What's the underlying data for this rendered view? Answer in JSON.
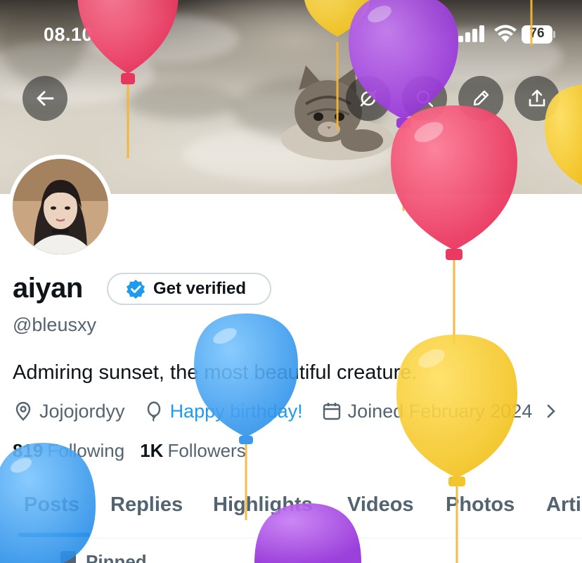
{
  "status_bar": {
    "time": "08.10",
    "battery": "76"
  },
  "profile": {
    "name": "aiyan",
    "verify_label": "Get verified",
    "handle": "@bleusxy",
    "bio": "Admiring sunset, the most beautiful creature.",
    "location": "Jojojordyy",
    "birthday": "Happy birthday!",
    "joined": "Joined February 2024",
    "following_count": "819",
    "following_label": "Following",
    "followers_count": "1K",
    "followers_label": "Followers"
  },
  "tabs": [
    "Posts",
    "Replies",
    "Highlights",
    "Videos",
    "Photos",
    "Arti"
  ],
  "active_tab": "Posts",
  "pinned_label": "Pinned",
  "icons": {
    "back": "arrow-left-icon",
    "grok": "grok-icon",
    "search": "search-icon",
    "edit": "pencil-icon",
    "share": "share-icon",
    "location": "location-pin-icon",
    "birthday": "balloon-icon",
    "joined": "calendar-icon",
    "verified": "verified-badge-icon"
  },
  "colors": {
    "accent": "#1d9bf0",
    "text_primary": "#0f1419",
    "text_secondary": "#536471",
    "balloon_red": "#f04a6e",
    "balloon_purple": "#a040e0",
    "balloon_yellow": "#f5cc2a",
    "balloon_blue": "#3ea5f2"
  }
}
